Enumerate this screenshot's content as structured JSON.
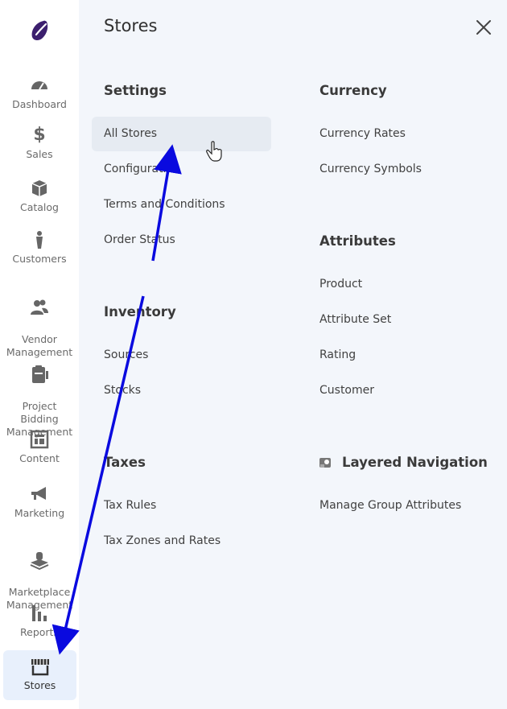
{
  "sidebar": {
    "items": [
      {
        "label": "Dashboard",
        "icon": "gauge-icon"
      },
      {
        "label": "Sales",
        "icon": "dollar-icon"
      },
      {
        "label": "Catalog",
        "icon": "box-icon"
      },
      {
        "label": "Customers",
        "icon": "person-icon"
      },
      {
        "label": "Vendor\nManagement",
        "icon": "users-icon"
      },
      {
        "label": "Project\nBidding\nManagement",
        "icon": "clipboard-icon"
      },
      {
        "label": "Content",
        "icon": "layout-icon"
      },
      {
        "label": "Marketing",
        "icon": "megaphone-icon"
      },
      {
        "label": "Marketplace\nManagement",
        "icon": "marketplace-icon"
      },
      {
        "label": "Reports",
        "icon": "bar-chart-icon"
      },
      {
        "label": "Stores",
        "icon": "storefront-icon",
        "active": true
      }
    ]
  },
  "panel": {
    "title": "Stores",
    "settings": {
      "heading": "Settings",
      "items": [
        "All Stores",
        "Configuration",
        "Terms and Conditions",
        "Order Status"
      ]
    },
    "inventory": {
      "heading": "Inventory",
      "items": [
        "Sources",
        "Stocks"
      ]
    },
    "taxes": {
      "heading": "Taxes",
      "items": [
        "Tax Rules",
        "Tax Zones and Rates"
      ]
    },
    "currency": {
      "heading": "Currency",
      "items": [
        "Currency Rates",
        "Currency Symbols"
      ]
    },
    "attributes": {
      "heading": "Attributes",
      "items": [
        "Product",
        "Attribute Set",
        "Rating",
        "Customer"
      ]
    },
    "layered": {
      "heading": "Layered Navigation",
      "items": [
        "Manage Group Attributes"
      ]
    }
  },
  "colors": {
    "accent": "#0a0adf",
    "logo": "#3c1f6e",
    "active_bg": "#e8f0fc",
    "panel_bg": "#f3f6fb"
  }
}
